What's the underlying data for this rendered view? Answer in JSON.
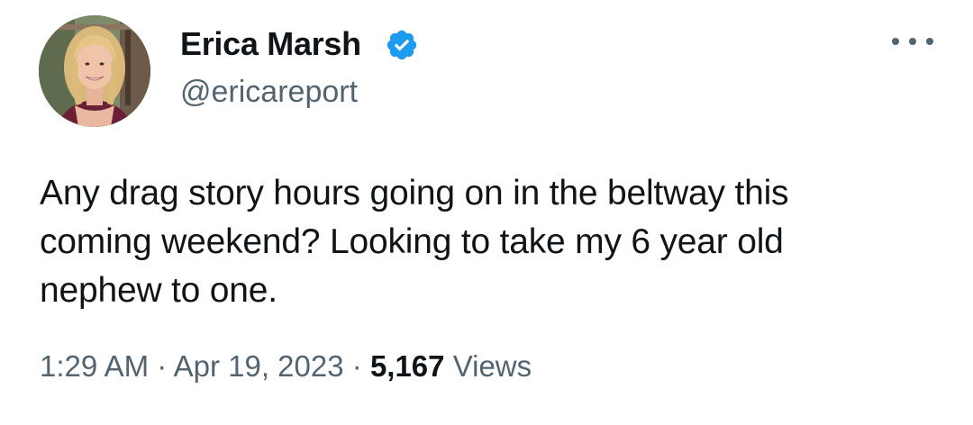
{
  "author": {
    "display_name": "Erica Marsh",
    "handle": "@ericareport",
    "verified": true,
    "verified_color": "#1d9bf0"
  },
  "tweet": {
    "text": "Any drag story hours going on in the beltway this\ncoming weekend? Looking to take my 6 year old\nnephew to one.",
    "time": "1:29 AM",
    "separator": "·",
    "date": "Apr 19, 2023",
    "views_count": "5,167",
    "views_label": "Views"
  },
  "icons": {
    "verified": "verified-badge-icon",
    "more": "more-horizontal-icon"
  }
}
